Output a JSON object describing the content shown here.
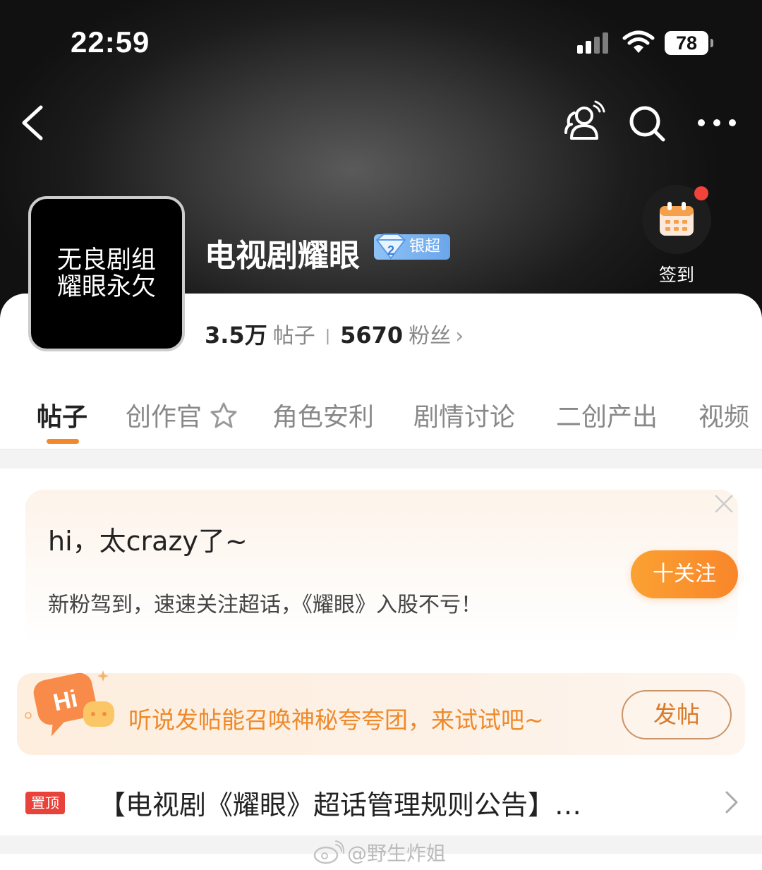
{
  "status_bar": {
    "time": "22:59",
    "battery": "78"
  },
  "nav": {
    "back_icon": "chevron-left-icon",
    "icons": [
      "people-icon",
      "search-icon",
      "more-icon"
    ]
  },
  "topic": {
    "avatar_lines": [
      "无良剧组",
      "耀眼永欠"
    ],
    "title": "电视剧耀眼",
    "badge_label": "银超",
    "badge_level": "2",
    "checkin_label": "签到",
    "posts_count": "3.5万",
    "posts_label": "帖子",
    "fans_count": "5670",
    "fans_label": "粉丝"
  },
  "tabs": [
    {
      "label": "帖子",
      "active": true
    },
    {
      "label": "创作官",
      "active": false
    },
    {
      "label": "角色安利",
      "active": false
    },
    {
      "label": "剧情讨论",
      "active": false
    },
    {
      "label": "二创产出",
      "active": false
    },
    {
      "label": "视频",
      "active": false
    }
  ],
  "welcome": {
    "title": "hi，太crazy了~",
    "subtitle": "新粉驾到，速速关注超话，《耀眼》入股不亏！",
    "follow_button": "十关注"
  },
  "post_prompt": {
    "icon_text": "Hi",
    "text": "听说发帖能召唤神秘夸夸团，来试试吧~",
    "button": "发帖"
  },
  "pinned": {
    "badge": "置顶",
    "title": "【电视剧《耀眼》超话管理规则公告】…"
  },
  "watermark": "@野生炸姐",
  "colors": {
    "accent_orange": "#f9862a",
    "pin_red": "#e8423a",
    "badge_blue": "#6aa6ec"
  }
}
